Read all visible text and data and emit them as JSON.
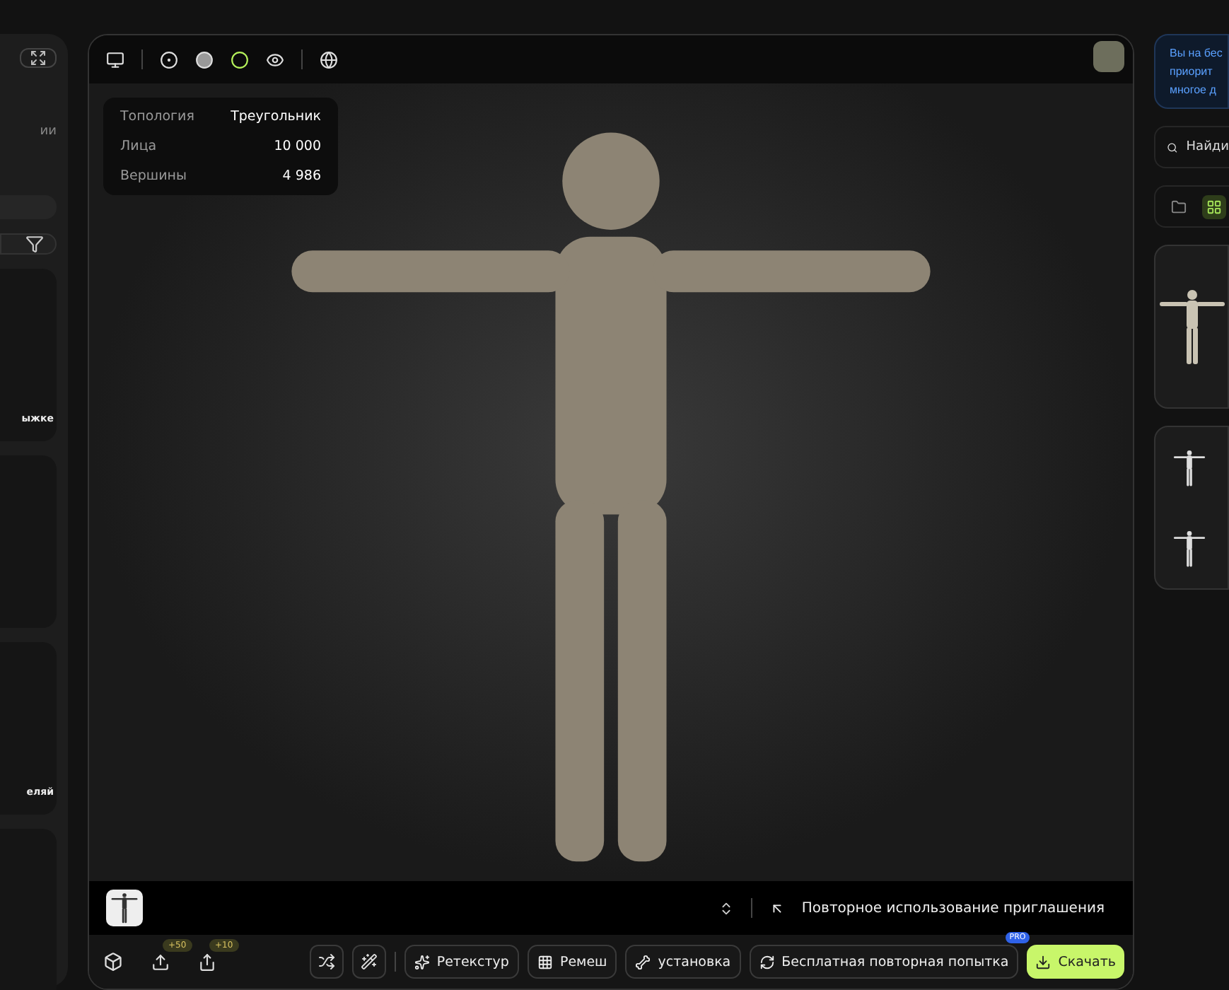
{
  "left_panel": {
    "caption": "ии",
    "cards": [
      {
        "kind": "titled",
        "label": "ыжке"
      },
      {
        "kind": "plain"
      },
      {
        "kind": "titled",
        "label": "еляй"
      },
      {
        "kind": "plain"
      }
    ]
  },
  "viewer": {
    "toolbar": [
      {
        "kind": "monitor",
        "selected": false
      },
      {
        "kind": "half",
        "selected": false
      },
      {
        "kind": "solid",
        "selected": false
      },
      {
        "kind": "ring",
        "selected": true
      },
      {
        "kind": "eye",
        "selected": false
      },
      {
        "kind": "globe",
        "selected": false
      }
    ],
    "info": [
      {
        "label": "Топология",
        "value": "Треугольник"
      },
      {
        "label": "Лица",
        "value": "10 000"
      },
      {
        "label": "Вершины",
        "value": "4 986"
      }
    ],
    "reuse_link": "Повторное использование приглашения",
    "counters": [
      {
        "kind": "upload",
        "badge": "+50"
      },
      {
        "kind": "share",
        "badge": "+10"
      }
    ],
    "actions": [
      {
        "kind": "retexture",
        "label": "Ретекстур"
      },
      {
        "kind": "remesh",
        "label": "Ремеш"
      },
      {
        "kind": "rig",
        "label": "установка"
      },
      {
        "kind": "retry",
        "label": "Бесплатная повторная попытка",
        "badge": "PRO"
      }
    ],
    "download": {
      "label": "Скачать"
    }
  },
  "right_panel": {
    "notice": [
      "Вы на бес",
      "приорит",
      "многое д"
    ],
    "search": {
      "placeholder": "Найди"
    },
    "view_toggle": [
      {
        "kind": "folder",
        "selected": false
      },
      {
        "kind": "grid",
        "selected": true
      }
    ]
  }
}
